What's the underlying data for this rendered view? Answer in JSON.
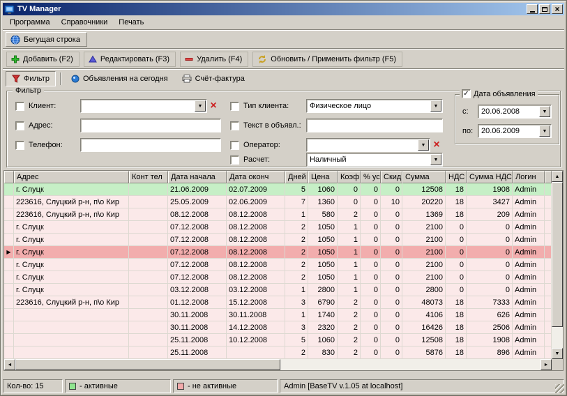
{
  "window": {
    "title": "TV Manager"
  },
  "menu": {
    "program": "Программа",
    "directories": "Справочники",
    "print": "Печать"
  },
  "toolbar": {
    "running_label": "Бегущая строка",
    "add_label": "Добавить (F2)",
    "edit_label": "Редактировать (F3)",
    "delete_label": "Удалить (F4)",
    "refresh_label": "Обновить / Применить фильтр (F5)"
  },
  "tabs": {
    "filter_label": "Фильтр",
    "today_label": "Объявления на сегодня",
    "invoice_label": "Счёт-фактура"
  },
  "filter": {
    "group_label": "Фильтр",
    "client_label": "Клиент:",
    "client_value": "",
    "address_label": "Адрес:",
    "address_value": "",
    "phone_label": "Телефон:",
    "phone_value": "",
    "client_type_label": "Тип клиента:",
    "client_type_value": "Физическое лицо",
    "text_label": "Текст в объявл.:",
    "text_value": "",
    "operator_label": "Оператор:",
    "operator_value": "",
    "calc_label": "Расчет:",
    "calc_value": "Наличный",
    "date_group_label": "Дата объявления",
    "date_from_label": "с:",
    "date_from_value": "20.06.2008",
    "date_to_label": "по:",
    "date_to_value": "20.06.2009"
  },
  "grid": {
    "columns": [
      "Адрес",
      "Конт тел",
      "Дата начала",
      "Дата оконч",
      "Дней",
      "Цена",
      "Коэф",
      "% ус",
      "Скид",
      "Сумма",
      "НДС",
      "Сумма НДС",
      "Логин"
    ],
    "rows": [
      {
        "state": "active",
        "selected": false,
        "cells": [
          "г. Слуцк",
          "",
          "21.06.2009",
          "02.07.2009",
          "5",
          "1060",
          "0",
          "0",
          "0",
          "12508",
          "18",
          "1908",
          "Admin"
        ]
      },
      {
        "state": "inactive",
        "selected": false,
        "cells": [
          "223616, Слуцкий р-н, п\\о Кир",
          "",
          "25.05.2009",
          "02.06.2009",
          "7",
          "1360",
          "0",
          "0",
          "10",
          "20220",
          "18",
          "3427",
          "Admin"
        ]
      },
      {
        "state": "inactive",
        "selected": false,
        "cells": [
          "223616, Слуцкий р-н, п\\о Кир",
          "",
          "08.12.2008",
          "08.12.2008",
          "1",
          "580",
          "2",
          "0",
          "0",
          "1369",
          "18",
          "209",
          "Admin"
        ]
      },
      {
        "state": "inactive",
        "selected": false,
        "cells": [
          "г. Слуцк",
          "",
          "07.12.2008",
          "08.12.2008",
          "2",
          "1050",
          "1",
          "0",
          "0",
          "2100",
          "0",
          "0",
          "Admin"
        ]
      },
      {
        "state": "inactive",
        "selected": false,
        "cells": [
          "г. Слуцк",
          "",
          "07.12.2008",
          "08.12.2008",
          "2",
          "1050",
          "1",
          "0",
          "0",
          "2100",
          "0",
          "0",
          "Admin"
        ]
      },
      {
        "state": "inactive",
        "selected": true,
        "cells": [
          "г. Слуцк",
          "",
          "07.12.2008",
          "08.12.2008",
          "2",
          "1050",
          "1",
          "0",
          "0",
          "2100",
          "0",
          "0",
          "Admin"
        ]
      },
      {
        "state": "inactive",
        "selected": false,
        "cells": [
          "г. Слуцк",
          "",
          "07.12.2008",
          "08.12.2008",
          "2",
          "1050",
          "1",
          "0",
          "0",
          "2100",
          "0",
          "0",
          "Admin"
        ]
      },
      {
        "state": "inactive",
        "selected": false,
        "cells": [
          "г. Слуцк",
          "",
          "07.12.2008",
          "08.12.2008",
          "2",
          "1050",
          "1",
          "0",
          "0",
          "2100",
          "0",
          "0",
          "Admin"
        ]
      },
      {
        "state": "inactive",
        "selected": false,
        "cells": [
          "г. Слуцк",
          "",
          "03.12.2008",
          "03.12.2008",
          "1",
          "2800",
          "1",
          "0",
          "0",
          "2800",
          "0",
          "0",
          "Admin"
        ]
      },
      {
        "state": "inactive",
        "selected": false,
        "cells": [
          "223616, Слуцкий р-н, п\\о Кир",
          "",
          "01.12.2008",
          "15.12.2008",
          "3",
          "6790",
          "2",
          "0",
          "0",
          "48073",
          "18",
          "7333",
          "Admin"
        ]
      },
      {
        "state": "inactive",
        "selected": false,
        "cells": [
          "",
          "",
          "30.11.2008",
          "30.11.2008",
          "1",
          "1740",
          "2",
          "0",
          "0",
          "4106",
          "18",
          "626",
          "Admin"
        ]
      },
      {
        "state": "inactive",
        "selected": false,
        "cells": [
          "",
          "",
          "30.11.2008",
          "14.12.2008",
          "3",
          "2320",
          "2",
          "0",
          "0",
          "16426",
          "18",
          "2506",
          "Admin"
        ]
      },
      {
        "state": "inactive",
        "selected": false,
        "cells": [
          "",
          "",
          "25.11.2008",
          "10.12.2008",
          "5",
          "1060",
          "2",
          "0",
          "0",
          "12508",
          "18",
          "1908",
          "Admin"
        ]
      },
      {
        "state": "inactive",
        "selected": false,
        "cells": [
          "",
          "",
          "25.11.2008",
          "",
          "2",
          "830",
          "2",
          "0",
          "0",
          "5876",
          "18",
          "896",
          "Admin"
        ]
      }
    ]
  },
  "statusbar": {
    "count": "Кол-во: 15",
    "active_legend": "- активные",
    "inactive_legend": "- не активные",
    "session": "Admin [BaseTV v.1.05 at localhost]"
  },
  "colors": {
    "row_active": "#c6efc6",
    "row_inactive": "#fbe9e9",
    "row_selected": "#f2adad",
    "titlebar_start": "#0a246a",
    "titlebar_end": "#a6caf0",
    "legend_active_fill": "#8fe58f",
    "legend_inactive_fill": "#f2aaaa",
    "clear_button": "#cc2222"
  }
}
